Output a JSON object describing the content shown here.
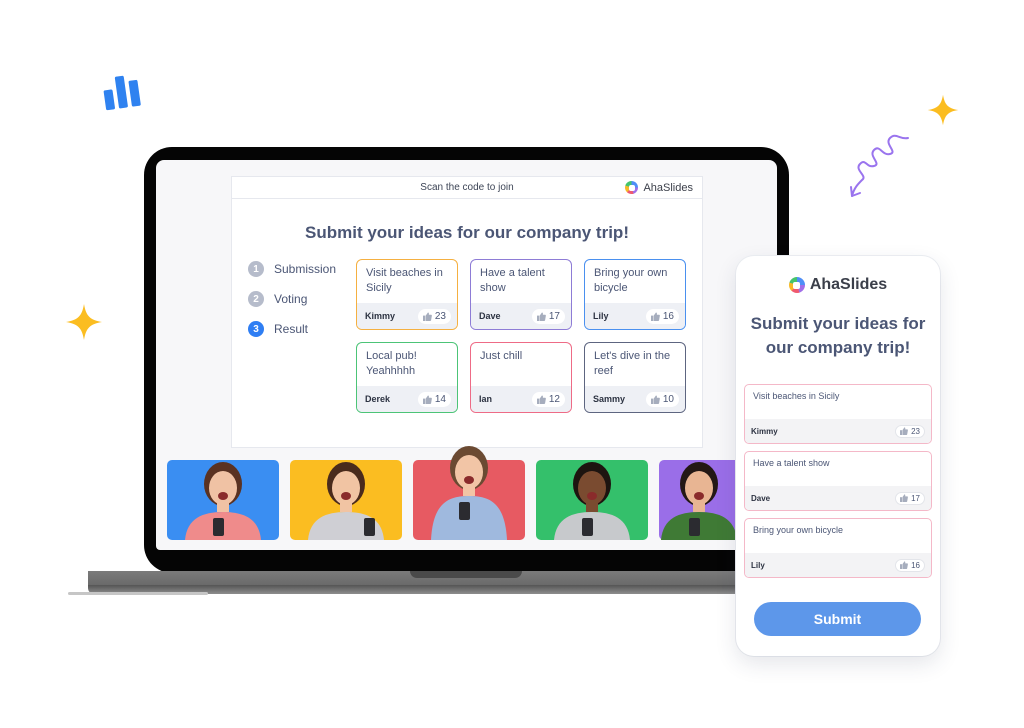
{
  "slide": {
    "header_text": "Scan the code to join",
    "brand_name": "AhaSlides",
    "title": "Submit your ideas for our company trip!",
    "steps": [
      {
        "number": "1",
        "label": "Submission",
        "active": false
      },
      {
        "number": "2",
        "label": "Voting",
        "active": false
      },
      {
        "number": "3",
        "label": "Result",
        "active": true
      }
    ],
    "ideas": [
      {
        "text": "Visit beaches in Sicily",
        "author": "Kimmy",
        "likes": "23",
        "border_color": "#f5b041"
      },
      {
        "text": "Have a talent show",
        "author": "Dave",
        "likes": "17",
        "border_color": "#8e7cd6"
      },
      {
        "text": "Bring your own bicycle",
        "author": "Lily",
        "likes": "16",
        "border_color": "#4a90ef"
      },
      {
        "text": "Local pub! Yeahhhhh",
        "author": "Derek",
        "likes": "14",
        "border_color": "#4cc477"
      },
      {
        "text": "Just chill",
        "author": "Ian",
        "likes": "12",
        "border_color": "#ee6b86"
      },
      {
        "text": "Let's dive in the reef",
        "author": "Sammy",
        "likes": "10",
        "border_color": "#5d6580"
      }
    ]
  },
  "photos": [
    {
      "label": "excited-woman-with-phone",
      "bg": "#3a8ef2"
    },
    {
      "label": "laughing-woman-with-phone",
      "bg": "#fbbd21"
    },
    {
      "label": "surprised-man-with-glasses",
      "bg": "#e75a62"
    },
    {
      "label": "cheering-man-in-hoodie",
      "bg": "#34c06b"
    },
    {
      "label": "laughing-woman",
      "bg": "#9a6ee8"
    }
  ],
  "phone": {
    "brand_name": "AhaSlides",
    "title": "Submit your ideas for our company trip!",
    "ideas": [
      {
        "text": "Visit beaches in Sicily",
        "author": "Kimmy",
        "likes": "23"
      },
      {
        "text": "Have a talent show",
        "author": "Dave",
        "likes": "17"
      },
      {
        "text": "Bring your own bicycle",
        "author": "Lily",
        "likes": "16"
      }
    ],
    "submit_label": "Submit"
  },
  "colors": {
    "accent_blue": "#2f7ef3",
    "submit_blue": "#5d97ea",
    "star_yellow": "#fbbd21",
    "spiral_purple": "#9a74ee"
  }
}
